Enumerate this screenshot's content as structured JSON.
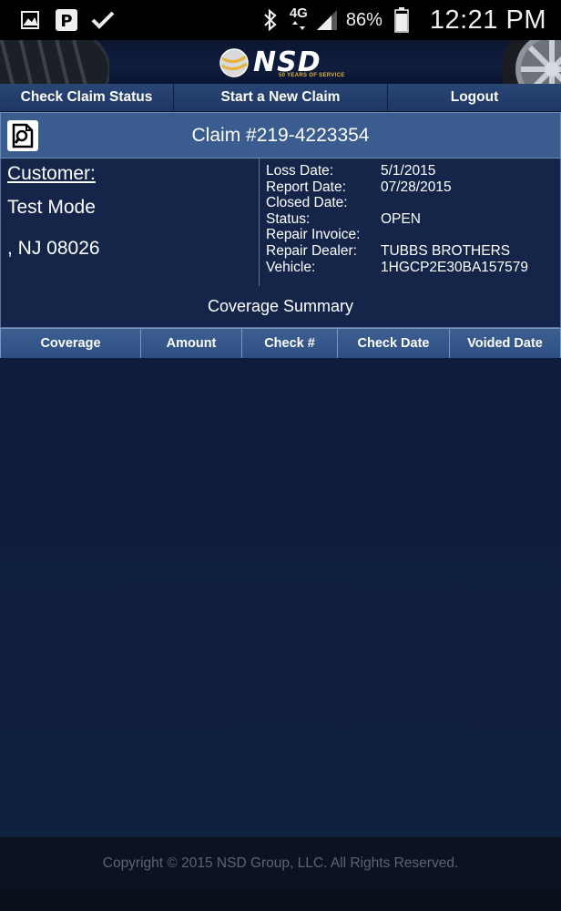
{
  "status_bar": {
    "network": "4G",
    "battery_percent": "86%",
    "time": "12:21 PM",
    "left_icons": [
      "gallery-icon",
      "parking-icon",
      "check-icon"
    ],
    "right_icons": [
      "bluetooth-icon",
      "network-4g-icon",
      "signal-icon",
      "battery-icon"
    ]
  },
  "header": {
    "logo_text": "NSD",
    "logo_subtext": "50 YEARS OF SERVICE"
  },
  "nav": {
    "items": [
      {
        "label": "Check Claim Status"
      },
      {
        "label": "Start a New Claim"
      },
      {
        "label": "Logout"
      }
    ]
  },
  "claim": {
    "title": "Claim #219-4223354"
  },
  "customer": {
    "label": "Customer:",
    "name": "Test Mode",
    "address": ", NJ 08026"
  },
  "details": [
    {
      "label": "Loss Date:",
      "value": "5/1/2015"
    },
    {
      "label": "Report Date:",
      "value": "07/28/2015"
    },
    {
      "label": "Closed Date:",
      "value": ""
    },
    {
      "label": "Status:",
      "value": "OPEN"
    },
    {
      "label": "Repair Invoice:",
      "value": ""
    },
    {
      "label": "Repair Dealer:",
      "value": "TUBBS BROTHERS"
    },
    {
      "label": "Vehicle:",
      "value": "1HGCP2E30BA157579"
    }
  ],
  "coverage": {
    "title": "Coverage Summary",
    "columns": [
      "Coverage",
      "Amount",
      "Check #",
      "Check Date",
      "Voided Date"
    ]
  },
  "footer": {
    "copyright": "Copyright © 2015 NSD Group, LLC. All Rights Reserved."
  },
  "colors": {
    "nav_bg": "#24406e",
    "claim_bar_bg": "#3a5c8e",
    "panel_bg": "#15254a",
    "page_bg": "#0f1d3d",
    "logo_accent": "#e7b23a"
  }
}
